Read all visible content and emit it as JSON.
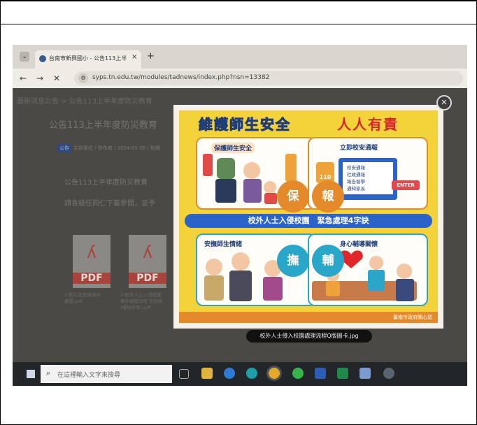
{
  "browser": {
    "tab_title": "台南市新興國小 - 公告113上半",
    "tab_close": "×",
    "new_tab": "+",
    "tab_list": "⌄",
    "back": "←",
    "forward": "→",
    "close_nav": "✕",
    "site_info": "⚙",
    "url": "syps.tn.edu.tw/modules/tadnews/index.php?nsn=13382"
  },
  "page": {
    "breadcrumb": "最新消息公告  >  公告113上半年度防災教育",
    "title": "公告113上半年度防災教育",
    "meta_tag": "公告",
    "meta_text": "主辦單位 / 發布者 / 2024-05-08 / 點閱",
    "paragraph1": "公告113上半年度防災教育",
    "paragraph2": "請各級任同仁下載參閱，並予",
    "files": [
      {
        "label": "PDF",
        "name": "1)防災及危機事件\n處置.pdf"
      },
      {
        "label": "PDF",
        "name": "2)校外人士入侵校園\n事件處理流程 及說明\n(僅供參考).pdf"
      }
    ]
  },
  "lightbox": {
    "title_left": "維護師生安全",
    "title_right": "人人有責",
    "q1": "保護師生安全",
    "q2": "立即校安通報",
    "q3": "安撫師生情緒",
    "q4": "身心輔導關懷",
    "c1": "保",
    "c2": "報",
    "c3": "撫",
    "c4": "輔",
    "center_bar": "校外人士入侵校園　緊急處理4字訣",
    "report_lines": [
      "校安通報",
      "社政通報",
      "報告督學",
      "通知家長"
    ],
    "hotline": "110",
    "enter": "ENTER",
    "footer": "臺南市政府關心您",
    "caption": "校外人士侵入校園處理流程Q版圖卡.jpg",
    "close": "✕"
  },
  "taskbar": {
    "search_placeholder": "在這裡輸入文字來搜尋",
    "search_icon": "⌕"
  },
  "colors": {
    "accent_blue": "#2c63c8",
    "poster_yellow": "#f4d23a",
    "poster_red": "#d8262b",
    "pdf_red": "#a8443c"
  }
}
